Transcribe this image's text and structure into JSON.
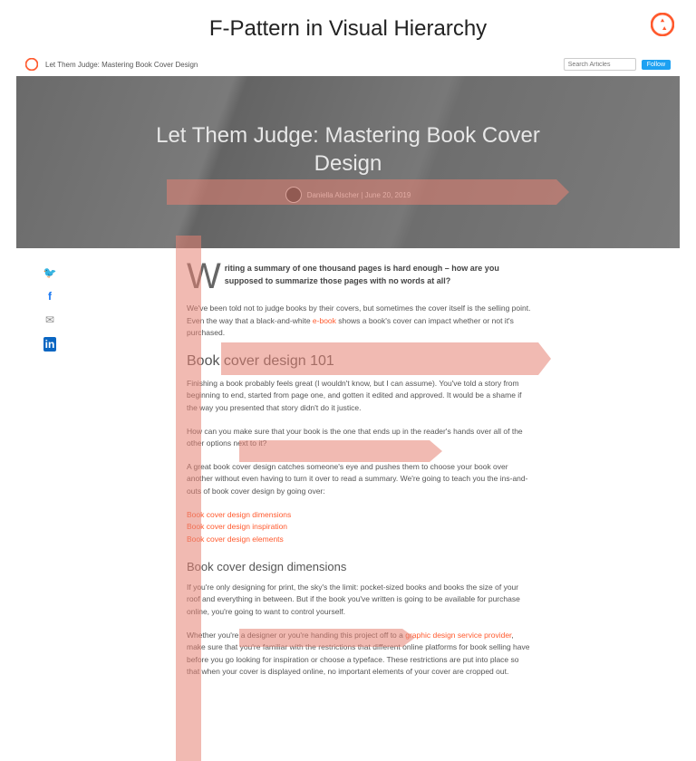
{
  "page": {
    "title": "F-Pattern in Visual Hierarchy"
  },
  "topbar": {
    "breadcrumb": "Let Them Judge: Mastering Book Cover Design",
    "search_placeholder": "Search Articles",
    "follow_label": "Follow"
  },
  "hero": {
    "title_line1": "Let Them Judge: Mastering Book Cover",
    "title_line2": "Design",
    "author": "Daniella Alscher",
    "date": "June 20, 2019",
    "byline_sep": " | "
  },
  "social": {
    "twitter": "twitter-icon",
    "facebook": "facebook-icon",
    "email": "email-icon",
    "linkedin": "linkedin-icon"
  },
  "article": {
    "dropcap": "W",
    "lede": "riting a summary of one thousand pages is hard enough – how are you supposed to summarize those pages with no words at all?",
    "p1a": "We've been told not to judge books by their covers, but sometimes the cover itself is the selling point. Even the way that a black-and-white ",
    "p1_link": "e-book",
    "p1b": " shows a book's cover can impact whether or not it's purchased.",
    "h2": "Book cover design 101",
    "p2": "Finishing a book probably feels great (I wouldn't know, but I can assume). You've told a story from beginning to end, started from page one, and gotten it edited and approved. It would be a shame if the way you presented that story didn't do it justice.",
    "p3": "How can you make sure that your book is the one that ends up in the reader's hands over all of the other options next to it?",
    "p4": "A great book cover design catches someone's eye and pushes them to choose your book over another without even having to turn it over to read a summary. We're going to teach you the ins-and-outs of book cover design by going over:",
    "toc": {
      "a": "Book cover design dimensions",
      "b": "Book cover design inspiration",
      "c": "Book cover design elements"
    },
    "h3": "Book cover design dimensions",
    "p5": "If you're only designing for print, the sky's the limit: pocket-sized books and books the size of your roof and everything in between. But if the book you've written is going to be available for purchase online, you're going to want to control yourself.",
    "p6a": "Whether you're a designer or you're handing this project off to a ",
    "p6_link": "graphic design service provider",
    "p6b": ", make sure that you're familiar with the restrictions that different online platforms for book selling have before you go looking for inspiration or choose a typeface. These restrictions are put into place so that when your cover is displayed online, no important elements of your cover are cropped out."
  }
}
